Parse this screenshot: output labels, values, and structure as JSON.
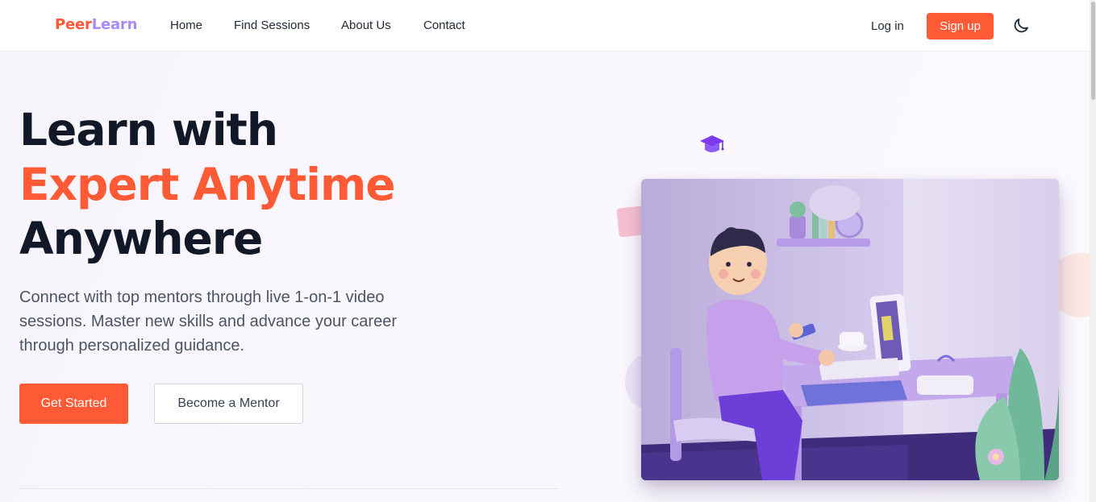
{
  "brand": {
    "part1": "Peer",
    "part2": "Learn"
  },
  "nav": {
    "links": [
      {
        "label": "Home"
      },
      {
        "label": "Find Sessions"
      },
      {
        "label": "About Us"
      },
      {
        "label": "Contact"
      }
    ],
    "login_label": "Log in",
    "signup_label": "Sign up",
    "theme_icon": "moon-icon"
  },
  "hero": {
    "title_line1": "Learn with",
    "title_line2": "Expert Anytime",
    "title_line3": "Anywhere",
    "description": "Connect with top mentors through live 1-on-1 video sessions. Master new skills and advance your career through personalized guidance.",
    "primary_cta": "Get Started",
    "secondary_cta": "Become a Mentor",
    "badge_icon": "graduation-cap-icon",
    "illustration": "student-at-desk-illustration"
  },
  "colors": {
    "accent": "#ff5a36",
    "brand_secondary": "#a78bfa",
    "heading": "#111827",
    "body_text": "#4b5563"
  }
}
